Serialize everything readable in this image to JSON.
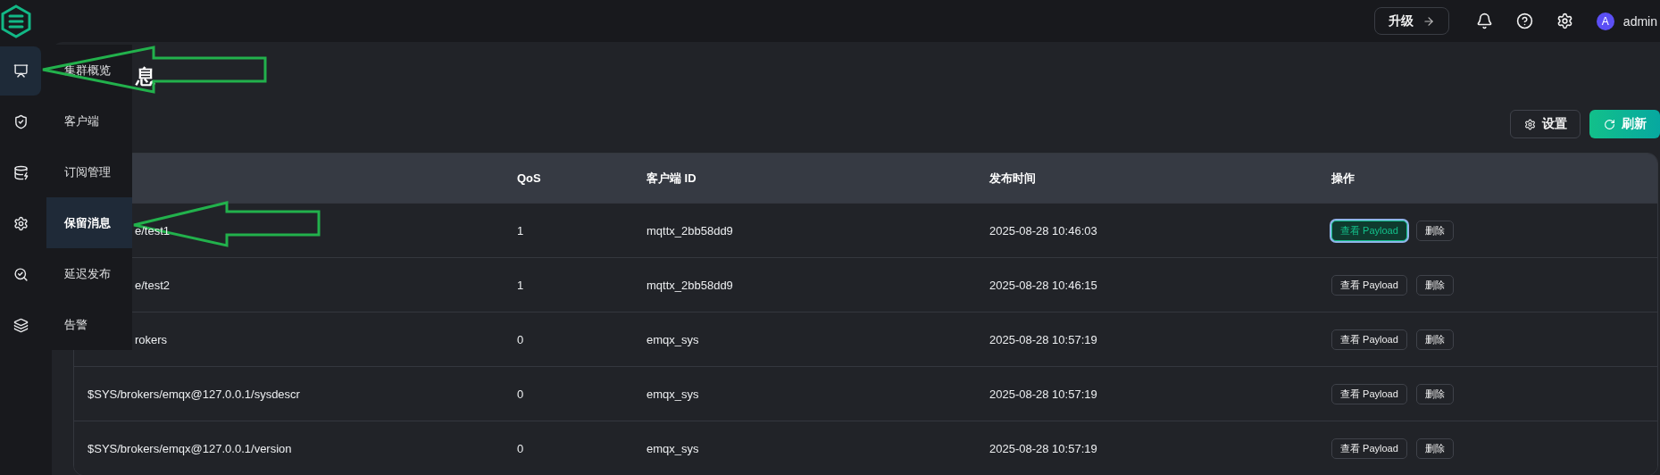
{
  "header": {
    "upgrade_button": "升级",
    "user": {
      "avatar": "A",
      "name": "admin"
    }
  },
  "rail": [
    {
      "selected": true
    },
    {
      "selected": false
    },
    {
      "selected": false
    },
    {
      "selected": false
    },
    {
      "selected": false
    },
    {
      "selected": false
    }
  ],
  "flyout_menu": [
    {
      "label": "集群概览",
      "selected": false
    },
    {
      "label": "客户端",
      "selected": false
    },
    {
      "label": "订阅管理",
      "selected": false
    },
    {
      "label": "保留消息",
      "selected": true
    },
    {
      "label": "延迟发布",
      "selected": false
    },
    {
      "label": "告警",
      "selected": false
    }
  ],
  "page": {
    "title": "息",
    "toolbar": {
      "settings_button": "设置",
      "refresh_button": "刷新"
    }
  },
  "table": {
    "columns": [
      "QoS",
      "客户端 ID",
      "发布时间",
      "操作"
    ],
    "rows": [
      {
        "kind": "partial",
        "topic": "e/test1",
        "qos": "1",
        "client_id": "mqttx_2bb58dd9",
        "time": "2025-08-28 10:46:03",
        "view_button": "查看 Payload",
        "delete_button": "删除",
        "focused": true
      },
      {
        "kind": "partial",
        "topic": "e/test2",
        "qos": "1",
        "client_id": "mqttx_2bb58dd9",
        "time": "2025-08-28 10:46:15",
        "view_button": "查看 Payload",
        "delete_button": "删除",
        "focused": false
      },
      {
        "kind": "partial",
        "topic": "rokers",
        "qos": "0",
        "client_id": "emqx_sys",
        "time": "2025-08-28 10:57:19",
        "view_button": "查看 Payload",
        "delete_button": "删除",
        "focused": false
      },
      {
        "kind": "full",
        "topic": "$SYS/brokers/emqx@127.0.0.1/sysdescr",
        "qos": "0",
        "client_id": "emqx_sys",
        "time": "2025-08-28 10:57:19",
        "view_button": "查看 Payload",
        "delete_button": "删除",
        "focused": false
      },
      {
        "kind": "full",
        "topic": "$SYS/brokers/emqx@127.0.0.1/version",
        "qos": "0",
        "client_id": "emqx_sys",
        "time": "2025-08-28 10:57:19",
        "view_button": "查看 Payload",
        "delete_button": "删除",
        "focused": false
      }
    ]
  }
}
